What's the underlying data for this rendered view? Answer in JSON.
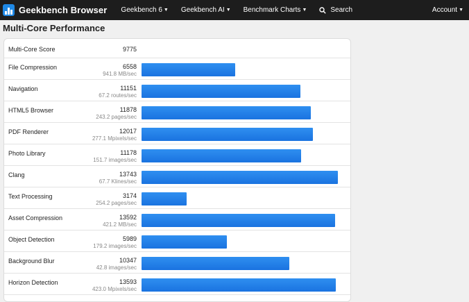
{
  "nav": {
    "brand": "Geekbench Browser",
    "items": [
      "Geekbench 6",
      "Geekbench AI",
      "Benchmark Charts"
    ],
    "search_label": "Search",
    "account_label": "Account"
  },
  "page": {
    "title": "Multi-Core Performance"
  },
  "score": {
    "label": "Multi-Core Score",
    "value": "9775"
  },
  "max_scale": 14200,
  "rows": [
    {
      "name": "File Compression",
      "score": "6558",
      "rate": "941.8 MB/sec",
      "num": 6558
    },
    {
      "name": "Navigation",
      "score": "11151",
      "rate": "67.2 routes/sec",
      "num": 11151
    },
    {
      "name": "HTML5 Browser",
      "score": "11878",
      "rate": "243.2 pages/sec",
      "num": 11878
    },
    {
      "name": "PDF Renderer",
      "score": "12017",
      "rate": "277.1 Mpixels/sec",
      "num": 12017
    },
    {
      "name": "Photo Library",
      "score": "11178",
      "rate": "151.7 images/sec",
      "num": 11178
    },
    {
      "name": "Clang",
      "score": "13743",
      "rate": "67.7 Klines/sec",
      "num": 13743
    },
    {
      "name": "Text Processing",
      "score": "3174",
      "rate": "254.2 pages/sec",
      "num": 3174
    },
    {
      "name": "Asset Compression",
      "score": "13592",
      "rate": "421.2 MB/sec",
      "num": 13592
    },
    {
      "name": "Object Detection",
      "score": "5989",
      "rate": "179.2 images/sec",
      "num": 5989
    },
    {
      "name": "Background Blur",
      "score": "10347",
      "rate": "42.8 images/sec",
      "num": 10347
    },
    {
      "name": "Horizon Detection",
      "score": "13593",
      "rate": "423.0 Mpixels/sec",
      "num": 13593
    }
  ]
}
